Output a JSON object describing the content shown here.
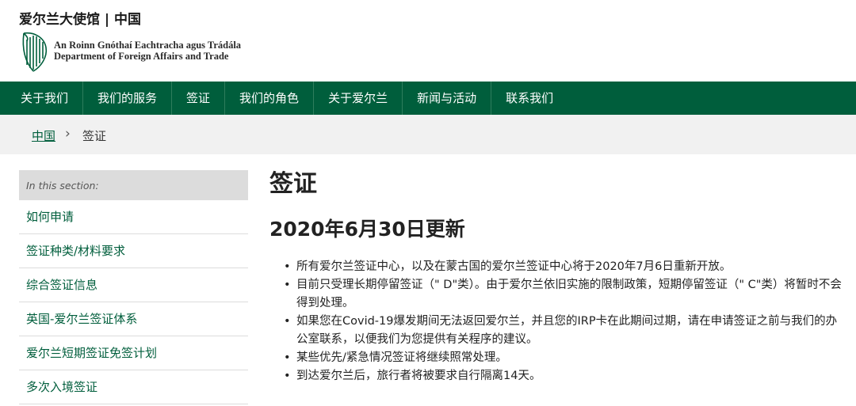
{
  "header": {
    "site_title": "爱尔兰大使馆 | 中国",
    "dept_irish": "An Roinn Gnóthaí Eachtracha agus Trádála",
    "dept_english": "Department of Foreign Affairs and Trade",
    "logo_icon": "harp-icon"
  },
  "nav": {
    "items": [
      "关于我们",
      "我们的服务",
      "签证",
      "我们的角色",
      "关于爱尔兰",
      "新闻与活动",
      "联系我们"
    ]
  },
  "breadcrumb": {
    "link": "中国",
    "separator": "›",
    "current": "签证"
  },
  "sidebar": {
    "heading": "In this section:",
    "items": [
      "如何申请",
      "签证种类/材料要求",
      "综合签证信息",
      "英国-爱尔兰签证体系",
      "爱尔兰短期签证免签计划",
      "多次入境签证"
    ]
  },
  "main": {
    "title": "签证",
    "update_heading": "2020年6月30日更新",
    "bullets": [
      "所有爱尔兰签证中心，以及在蒙古国的爱尔兰签证中心将于2020年7月6日重新开放。",
      "目前只受理长期停留签证（\" D\"类）。由于爱尔兰依旧实施的限制政策，短期停留签证（\" C\"类）将暂时不会得到处理。",
      "如果您在Covid-19爆发期间无法返回爱尔兰，并且您的IRP卡在此期间过期，请在申请签证之前与我们的办公室联系，以便我们为您提供有关程序的建议。",
      "某些优先/紧急情况签证将继续照常处理。",
      "到达爱尔兰后，旅行者将被要求自行隔离14天。"
    ],
    "bullet_mark": "•"
  },
  "colors": {
    "brand_green": "#005e3c",
    "breadcrumb_bg": "#f1f1f1",
    "sidebar_heading_bg": "#dcdcdc"
  }
}
